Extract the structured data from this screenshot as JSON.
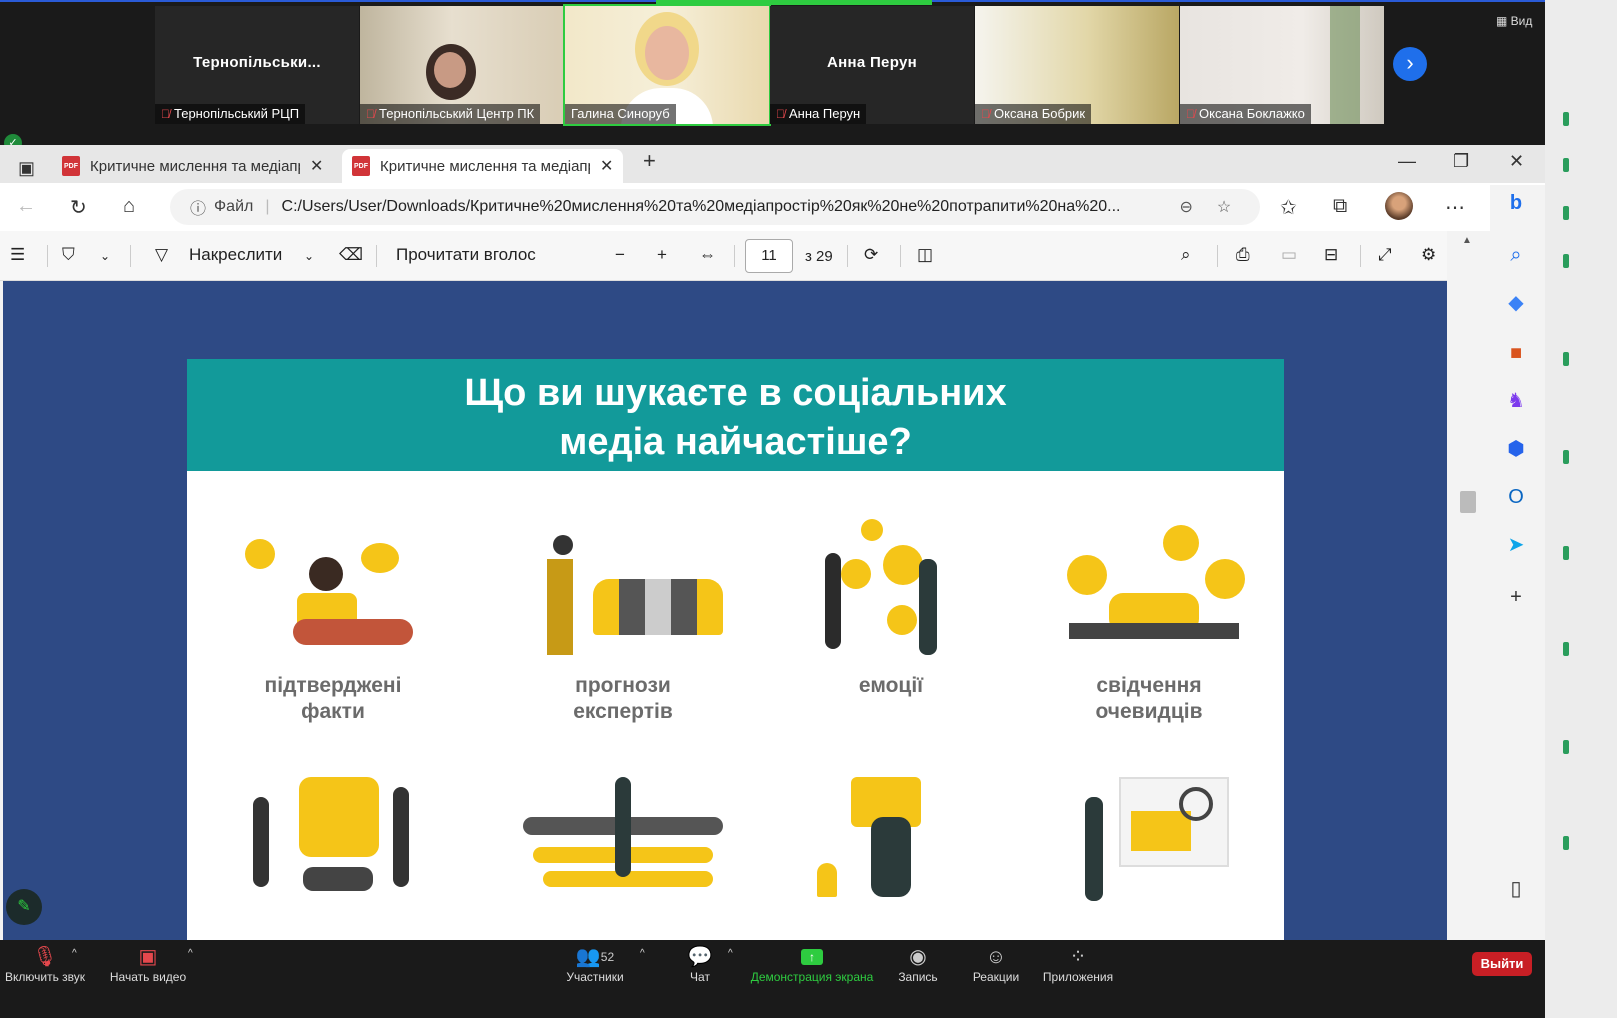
{
  "participants": [
    {
      "display": "Тернопільськи...",
      "label": "Тернопільський РЦП",
      "video": false
    },
    {
      "display": "",
      "label": "Тернопільський Центр ПК",
      "video": true
    },
    {
      "display": "",
      "label": "Галина Синоруб",
      "video": true,
      "speaking": true
    },
    {
      "display": "Анна Перун",
      "label": "Анна Перун",
      "video": false
    },
    {
      "display": "",
      "label": "Оксана Бобрик",
      "video": true
    },
    {
      "display": "",
      "label": "Оксана Боклажко",
      "video": true
    }
  ],
  "view_label": "Вид",
  "tabs": [
    {
      "title": "Критичне мислення та медіапр"
    },
    {
      "title": "Критичне мислення та медіапр"
    }
  ],
  "address": {
    "file_label": "Файл",
    "url": "C:/Users/User/Downloads/Критичне%20мислення%20та%20медіапростір%20як%20не%20потрапити%20на%20..."
  },
  "pdf_toolbar": {
    "draw_label": "Накреслити",
    "read_aloud_label": "Прочитати вголос",
    "page_current": "11",
    "page_total": "з 29"
  },
  "slide": {
    "title_line1": "Що ви шукаєте в соціальних",
    "title_line2": "медіа найчастіше?",
    "items": [
      {
        "line1": "підтверджені",
        "line2": "факти"
      },
      {
        "line1": "прогнози",
        "line2": "експертів"
      },
      {
        "line1": "емоції",
        "line2": ""
      },
      {
        "line1": "свідчення",
        "line2": "очевидців"
      }
    ]
  },
  "zoom_bar": {
    "unmute": "Включить звук",
    "start_video": "Начать видео",
    "participants": "Участники",
    "participants_count": "52",
    "chat": "Чат",
    "share": "Демонстрация экрана",
    "record": "Запись",
    "reactions": "Реакции",
    "apps": "Приложения",
    "exit": "Выйти"
  }
}
